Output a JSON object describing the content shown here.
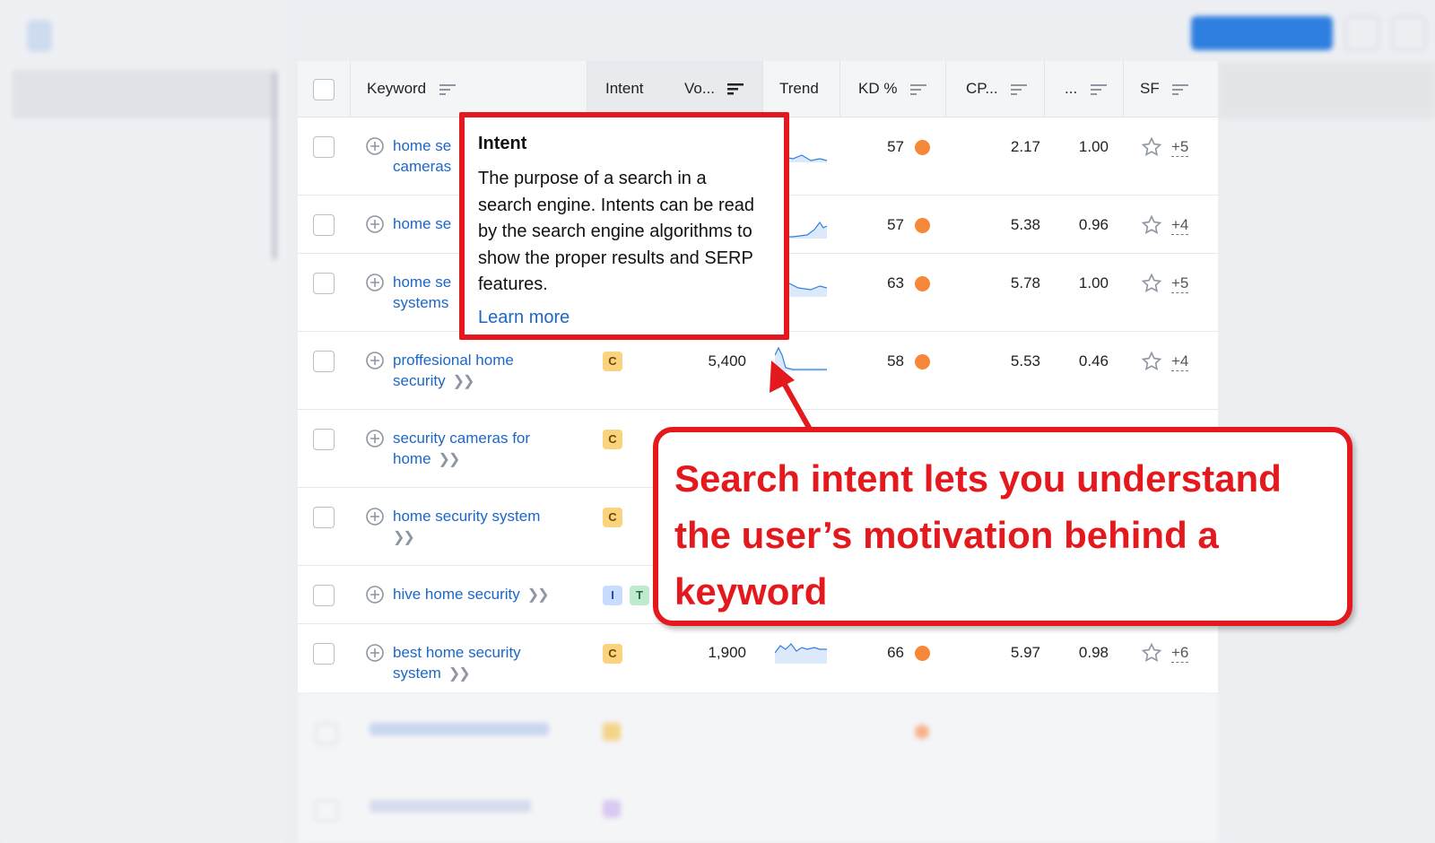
{
  "table": {
    "headers": {
      "keyword": "Keyword",
      "intent": "Intent",
      "volume": "Vo...",
      "trend": "Trend",
      "kd": "KD %",
      "cpc": "CP...",
      "competition": "...",
      "sf": "SF"
    },
    "rows": [
      {
        "keyword": "home se\ncameras",
        "intents": [],
        "volume": "",
        "kd": "57",
        "cpc": "2.17",
        "competition": "1.00",
        "sf": "+5"
      },
      {
        "keyword": "home se",
        "intents": [],
        "volume": "",
        "kd": "57",
        "cpc": "5.38",
        "competition": "0.96",
        "sf": "+4"
      },
      {
        "keyword": "home se\nsystems",
        "intents": [],
        "volume": "",
        "kd": "63",
        "cpc": "5.78",
        "competition": "1.00",
        "sf": "+5"
      },
      {
        "keyword": "proffesional home security",
        "intents": [
          "C"
        ],
        "volume": "5,400",
        "kd": "58",
        "cpc": "5.53",
        "competition": "0.46",
        "sf": "+4"
      },
      {
        "keyword": "security cameras for home",
        "intents": [
          "C"
        ],
        "volume": "",
        "kd": "",
        "cpc": "",
        "competition": "",
        "sf": ""
      },
      {
        "keyword": "home security system",
        "intents": [
          "C"
        ],
        "volume": "",
        "kd": "",
        "cpc": "",
        "competition": "",
        "sf": ""
      },
      {
        "keyword": "hive home security",
        "intents": [
          "I",
          "T"
        ],
        "volume": "",
        "kd": "",
        "cpc": "",
        "competition": "",
        "sf": ""
      },
      {
        "keyword": "best home security system",
        "intents": [
          "C"
        ],
        "volume": "1,900",
        "kd": "66",
        "cpc": "5.97",
        "competition": "0.98",
        "sf": "+6"
      }
    ]
  },
  "tooltip": {
    "title": "Intent",
    "body": "The purpose of a search in a search engine. Intents can be read by the search engine algorithms to show the proper results and SERP features.",
    "link": "Learn more"
  },
  "callout": {
    "text": "Search intent lets you understand the user’s motivation behind a keyword"
  },
  "colors": {
    "accent_red": "#e4191e",
    "link_blue": "#1b67c9",
    "kd_dot": "#f7883a"
  }
}
